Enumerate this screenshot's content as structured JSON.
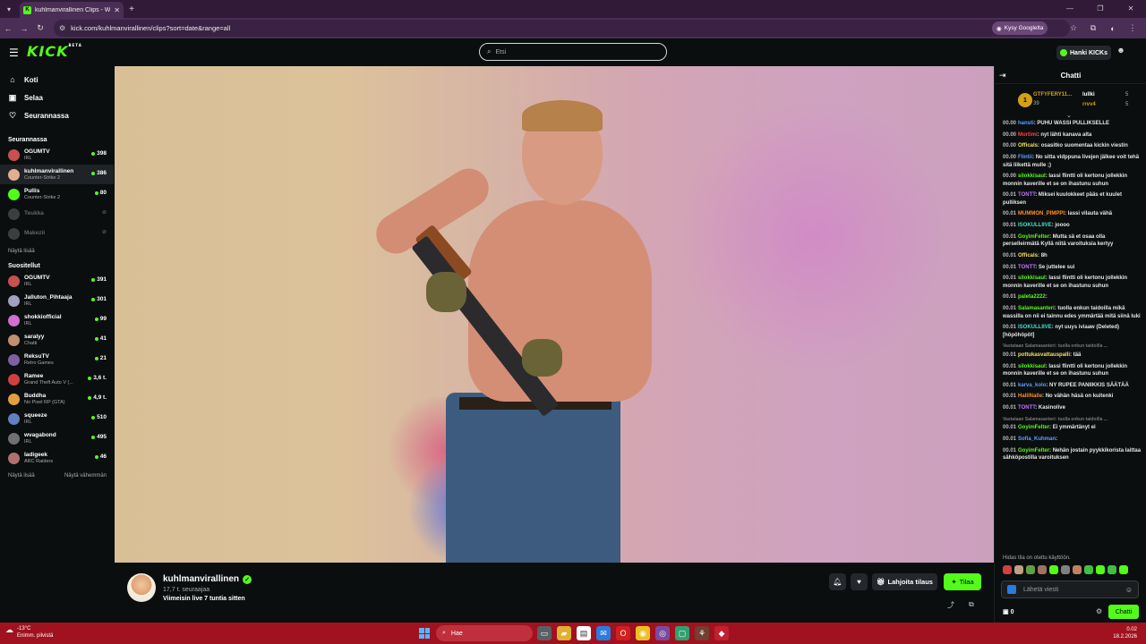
{
  "browser": {
    "tab_title": "kuhlmanvirallinen Clips - Watch",
    "url": "kick.com/kuhlmanvirallinen/clips?sort=date&range=all",
    "google_pill": "Kysy Googlelta"
  },
  "header": {
    "logo": "KICK",
    "logo_tag": "BETA",
    "search_placeholder": "Etsi",
    "get_kicks": "Hanki KICKs"
  },
  "sidebar": {
    "nav": [
      {
        "label": "Koti",
        "icon": "home-icon"
      },
      {
        "label": "Selaa",
        "icon": "browse-icon"
      },
      {
        "label": "Seurannassa",
        "icon": "heart-icon"
      }
    ],
    "following_heading": "Seurannassa",
    "following": [
      {
        "name": "OGUMTV",
        "category": "IRL",
        "viewers": "398",
        "color": "#c85050"
      },
      {
        "name": "kuhlmanvirallinen",
        "category": "Counter-Strike 2",
        "viewers": "386",
        "color": "#e0b090",
        "active": true
      },
      {
        "name": "Pullis",
        "category": "Counter-Strike 2",
        "viewers": "80",
        "color": "#53fc18"
      },
      {
        "name": "Teukka",
        "category": "",
        "viewers": "",
        "color": "#888888",
        "offline": true
      },
      {
        "name": "Makezii",
        "category": "",
        "viewers": "",
        "color": "#888888",
        "offline": true
      }
    ],
    "show_all_following": "Näytä lisää",
    "recommended_heading": "Suositellut",
    "recommended": [
      {
        "name": "OGUMTV",
        "category": "IRL",
        "viewers": "391",
        "color": "#c85050"
      },
      {
        "name": "Jalluton_Pihtaaja",
        "category": "IRL",
        "viewers": "301",
        "color": "#a0a0c0"
      },
      {
        "name": "shokkiofficial",
        "category": "IRL",
        "viewers": "99",
        "color": "#d070d0"
      },
      {
        "name": "saralyy",
        "category": "Chatti",
        "viewers": "41",
        "color": "#c09070"
      },
      {
        "name": "ReksuTV",
        "category": "Retro Games",
        "viewers": "21",
        "color": "#8060a0"
      },
      {
        "name": "Ramee",
        "category": "Grand Theft Auto V (...",
        "viewers": "3,6 t.",
        "color": "#d04040"
      },
      {
        "name": "Buddha",
        "category": "No Pixel RP (GTA)",
        "viewers": "4,9 t.",
        "color": "#e0a040"
      },
      {
        "name": "squeeze",
        "category": "IRL",
        "viewers": "510",
        "color": "#6080c0"
      },
      {
        "name": "wvagabond",
        "category": "IRL",
        "viewers": "495",
        "color": "#707070"
      },
      {
        "name": "ladigeek",
        "category": "ARC Raiders",
        "viewers": "46",
        "color": "#b07070"
      }
    ],
    "show_more": "Näytä lisää",
    "show_less": "Näytä vähemmän"
  },
  "channel": {
    "name": "kuhlmanvirallinen",
    "followers": "17,7 t. seuraajaa",
    "last_live": "Viimeisin live 7 tuntia sitten",
    "gift_label": "Lahjoita tilaus",
    "subscribe_label": "Tilaa"
  },
  "chat": {
    "title": "Chatti",
    "pinned": {
      "top_name": "GTFYFERY11...",
      "top_count": "39",
      "second_name": "lullki",
      "second_count": "5",
      "third_name": "rrvv4",
      "third_count": "5"
    },
    "messages": [
      {
        "time": "00.00",
        "user": "hansti",
        "color": "#5aa0ff",
        "text": "PUHU WASSI PULLIKSELLE"
      },
      {
        "time": "00.00",
        "user": "Mortimi",
        "color": "#ff4040",
        "text": "nyt lähti kanava alta"
      },
      {
        "time": "00.00",
        "user": "Officals",
        "color": "#f0e060",
        "text": "osasitko suomentaa kickin viestin"
      },
      {
        "time": "00.00",
        "user": "Flintii",
        "color": "#5aa0ff",
        "text": "No sitta vidppuna livejen jälkee voit tehä sitä liikettä mulle ;)"
      },
      {
        "time": "00.00",
        "user": "silokkisaul",
        "color": "#53fc18",
        "text": "lassi flintti oli kertonu jollekkin monnin kaverille et se on ihastunu suhun"
      },
      {
        "time": "00.01",
        "user": "TONTT",
        "color": "#c070ff",
        "text": "Miksei kuulokkeet pääs et kuulet pulliksen"
      },
      {
        "time": "00.01",
        "user": "MUMMON_PIMPPI",
        "color": "#ff9020",
        "text": "lassi vilauta vähä"
      },
      {
        "time": "00.01",
        "user": "ISOKULLIIVE",
        "color": "#40e0d0",
        "text": "joooo"
      },
      {
        "time": "00.01",
        "user": "GoyimFelter",
        "color": "#53fc18",
        "text": "Mutta sä et osaa olla perselleirmätä Kyllä niitä varoituksia kertyy"
      },
      {
        "time": "00.01",
        "user": "Officals",
        "color": "#f0e060",
        "text": "8h"
      },
      {
        "time": "00.01",
        "user": "TONTT",
        "color": "#c070ff",
        "text": "Se juttelee sui"
      },
      {
        "time": "00.01",
        "user": "silokkisaul",
        "color": "#53fc18",
        "text": "lassi flintti oli kertonu jollekkin monnin kaverille et se on ihastunu suhun"
      },
      {
        "time": "00.01",
        "user": "paleta2222",
        "color": "#53fc18",
        "text": ""
      },
      {
        "time": "00.01",
        "user": "Salamasanteri",
        "color": "#53fc18",
        "text": "tuolla enkun taidoilla mikä wassilla on nii ei tainnu edes ymmärtää mitä siinä luki"
      },
      {
        "time": "00.01",
        "user": "ISOKULLIIVE",
        "color": "#40e0d0",
        "text": "nyt uuys iviaaw (Deleted) [höpöhöpöt]"
      },
      {
        "time": "",
        "user": "",
        "color": "#777777",
        "text": "Vastataan Salamasanteri: tuolla enkun taidoilla ...",
        "reply": true
      },
      {
        "time": "00.01",
        "user": "pottukasvattauspalli",
        "color": "#f0e060",
        "text": "tää"
      },
      {
        "time": "00.01",
        "user": "silokkisaul",
        "color": "#53fc18",
        "text": "lassi flintti oli kertonu jollekkin monnin kaverille et se on ihastunu suhun"
      },
      {
        "time": "00.01",
        "user": "karva_kolo",
        "color": "#5aa0ff",
        "text": "NY RUPEE PANIIKKIS SÄÄTÄÄ"
      },
      {
        "time": "00.01",
        "user": "HalliNalle",
        "color": "#ff9020",
        "text": "No vähän häsä on kuitenki"
      },
      {
        "time": "00.01",
        "user": "TONTT",
        "color": "#c070ff",
        "text": "Kasinolive"
      },
      {
        "time": "",
        "user": "",
        "color": "#777777",
        "text": "Vastataan Salamasanteri: tuolla enkun taidoilla ...",
        "reply": true
      },
      {
        "time": "00.01",
        "user": "GoyimFelter",
        "color": "#53fc18",
        "text": "Ei ymmärtänyt ei"
      },
      {
        "time": "00.01",
        "user": "Sofia_Kuhman",
        "color": "#5aa0ff",
        "text": ""
      },
      {
        "time": "00.01",
        "user": "GoyimFelter",
        "color": "#53fc18",
        "text": "Nehän jostain pyykkikorista laittaa sähköpostilla varoituksen"
      }
    ],
    "slow_mode": "Hidas tila on otettu käyttöön.",
    "input_placeholder": "Lähetä viesti",
    "points": "0",
    "send_label": "Chatti"
  },
  "taskbar": {
    "temp": "-13°C",
    "weather_desc": "Enimm. pilvistä",
    "search": "Hae",
    "time": "0.02",
    "date": "18.2.2026"
  },
  "colors": {
    "accent": "#53fc18",
    "background": "#0b0e0f",
    "taskbar": "#a0121f"
  }
}
